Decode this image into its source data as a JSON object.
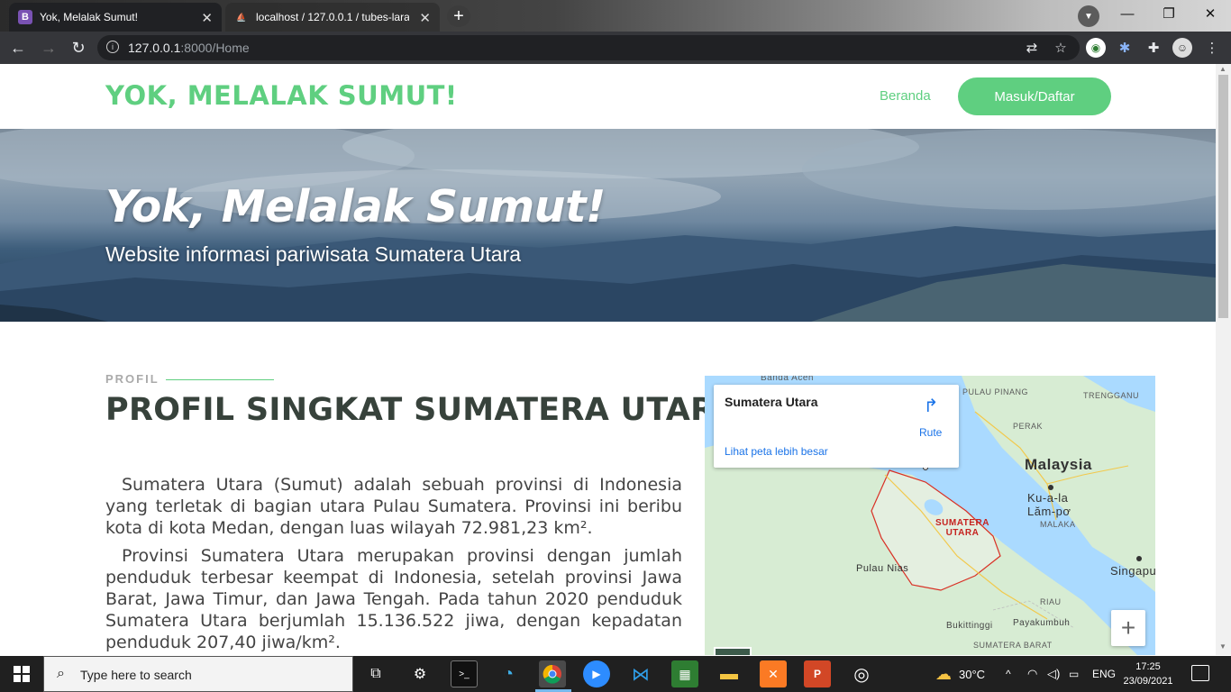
{
  "browser": {
    "tabs": [
      {
        "title": "Yok, Melalak Sumut!",
        "favicon": "B"
      },
      {
        "title": "localhost / 127.0.0.1 / tubes-larav",
        "favicon": "pma"
      }
    ],
    "url_host": "127.0.0.1",
    "url_rest": ":8000/Home",
    "window_controls": [
      "minimize-icon",
      "restore-icon",
      "close-icon"
    ]
  },
  "site": {
    "brand": "YOK, MELALAK SUMUT!",
    "nav": {
      "home": "Beranda",
      "login": "Masuk/Daftar"
    },
    "hero": {
      "title": "Yok, Melalak Sumut!",
      "subtitle": "Website informasi pariwisata Sumatera Utara"
    },
    "profile": {
      "label": "PROFIL",
      "title": "PROFIL SINGKAT SUMATERA UTARA",
      "para1": "Sumatera Utara (Sumut) adalah sebuah provinsi di Indonesia yang terletak di bagian utara Pulau Sumatera. Provinsi ini beribu kota di kota Medan, dengan luas wilayah 72.981,23 km².",
      "para2": "Provinsi Sumatera Utara merupakan provinsi dengan jumlah penduduk terbesar keempat di Indonesia, setelah provinsi Jawa Barat, Jawa Timur, dan Jawa Tengah. Pada tahun 2020 penduduk Sumatera Utara berjumlah 15.136.522 jiwa, dengan kepadatan penduduk 207,40 jiwa/km²."
    },
    "map": {
      "place": "Sumatera Utara",
      "route": "Rute",
      "larger_map": "Lihat peta lebih besar",
      "labels": {
        "banda_aceh": "Banda Aceh",
        "pulau_pinang": "PULAU PINANG",
        "terengganu": "TRENGGANU",
        "perak": "PERAK",
        "malaysia": "Malaysia",
        "kuala_lumpur": "Ku-a-la\nLăm-pơ",
        "malaka": "MALAKA",
        "sumut": "SUMATERA\nUTARA",
        "pulau_nias": "Pulau Nias",
        "singapore": "Singapu",
        "riau": "RIAU",
        "bukittinggi": "Bukittinggi",
        "payakumbuh": "Payakumbuh",
        "sumbar": "SUMATERA BARAT"
      },
      "zoom_in": "+"
    }
  },
  "taskbar": {
    "search_placeholder": "Type here to search",
    "weather": "30°C",
    "language": "ENG",
    "time": "17:25",
    "date": "23/09/2021"
  }
}
